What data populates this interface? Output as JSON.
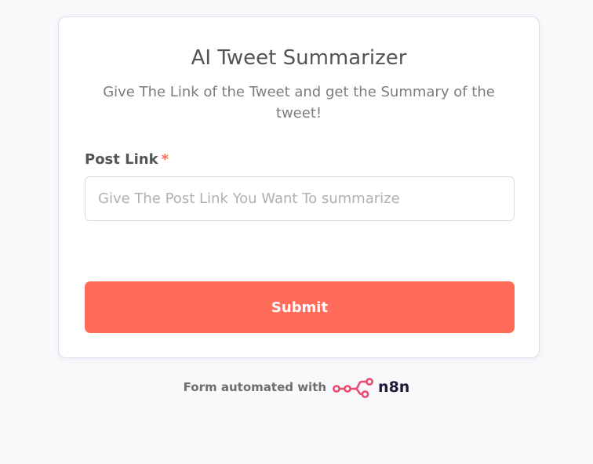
{
  "form": {
    "title": "AI Tweet Summarizer",
    "subtitle": "Give The Link of the Tweet and get the Summary of the tweet!",
    "field": {
      "label": "Post Link",
      "required_marker": "*",
      "value": "",
      "placeholder": "Give The Post Link You Want To summarize"
    },
    "submit_label": "Submit"
  },
  "footer": {
    "text": "Form automated with",
    "brand_name": "n8n",
    "brand_icon": "n8n-logo-icon"
  },
  "colors": {
    "accent": "#ff6d5a",
    "brand_dark": "#1f1b3a",
    "brand_pink": "#ea4b71"
  }
}
